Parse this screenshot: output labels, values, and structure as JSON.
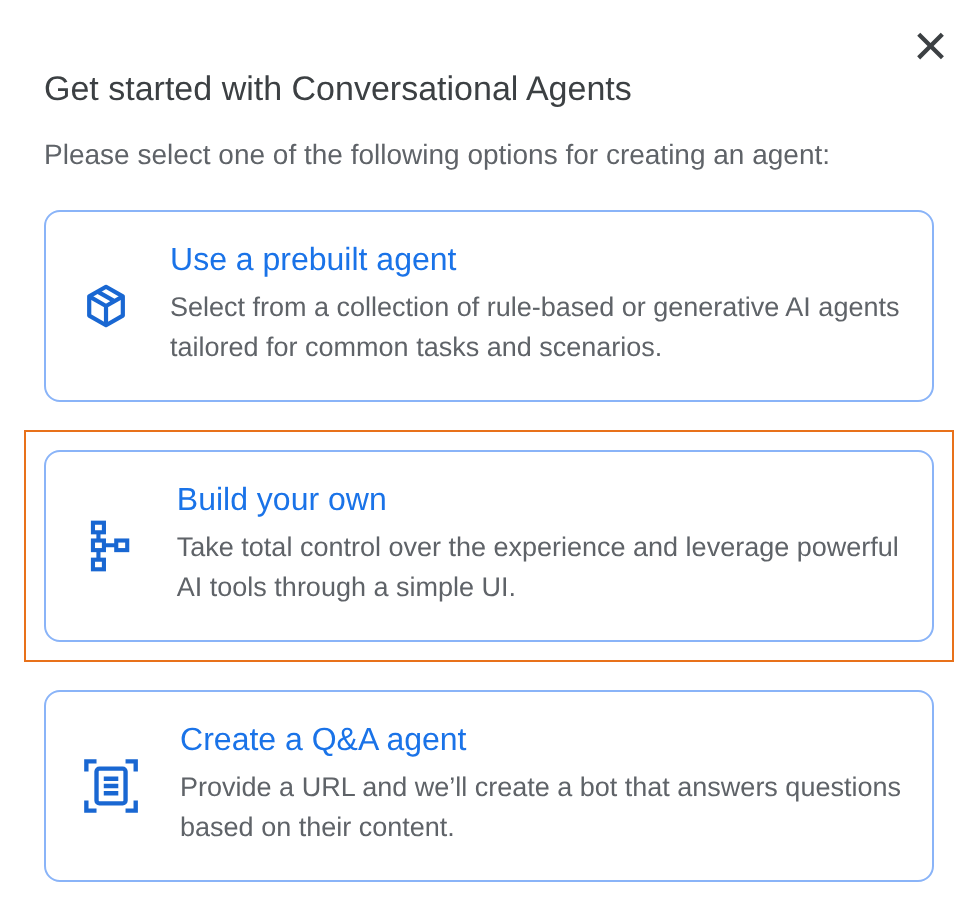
{
  "dialog": {
    "title": "Get started with Conversational Agents",
    "close": "×",
    "subtitle": "Please select one of the following options for creating an agent:"
  },
  "options": [
    {
      "kind": "prebuilt",
      "title": "Use a prebuilt agent",
      "description": "Select from a collection of rule-based or generative AI agents tailored for common tasks and scenarios.",
      "selected": false
    },
    {
      "kind": "build",
      "title": "Build your own",
      "description": "Take total control over the experience and leverage powerful AI tools through a simple UI.",
      "selected": true
    },
    {
      "kind": "qa",
      "title": "Create a Q&A agent",
      "description": "Provide a URL and we’ll create a bot that answers questions based on their content.",
      "selected": false
    }
  ]
}
